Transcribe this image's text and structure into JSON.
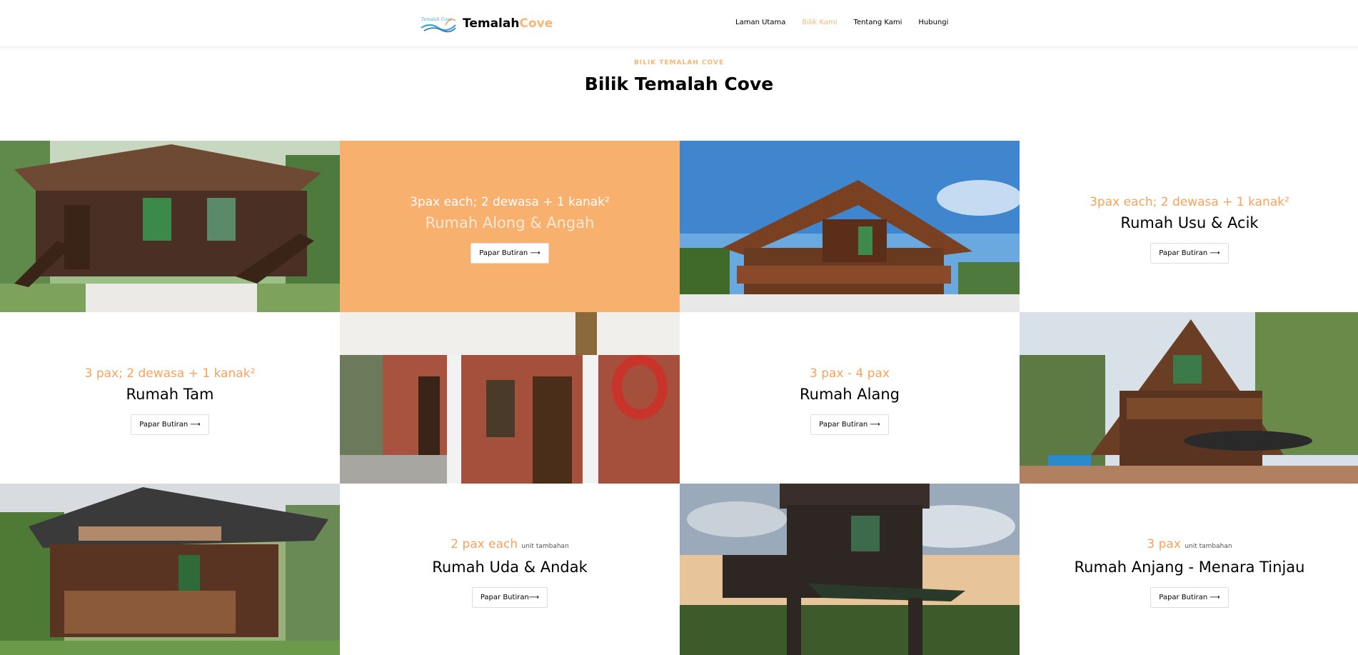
{
  "brand": {
    "logo_text": "Temalah Cove",
    "name_main": "Temalah",
    "name_accent": "Cove"
  },
  "nav": [
    {
      "label": "Laman Utama",
      "active": false
    },
    {
      "label": "Bilik Kami",
      "active": true
    },
    {
      "label": "Tentang Kami",
      "active": false
    },
    {
      "label": "Hubungi",
      "active": false
    }
  ],
  "section": {
    "subtitle": "BILIK TEMALAH COVE",
    "title": "Bilik Temalah Cove"
  },
  "rooms": [
    {
      "pax": "3pax each; 2 dewasa + 1 kanak²",
      "pax_note": "",
      "name": "Rumah Along & Angah",
      "button": "Papar Butiran ⟶"
    },
    {
      "pax": "3pax each; 2 dewasa + 1 kanak²",
      "pax_note": "",
      "name": "Rumah Usu & Acik",
      "button": "Papar Butiran ⟶"
    },
    {
      "pax": "3 pax; 2 dewasa + 1 kanak²",
      "pax_note": "",
      "name": "Rumah Tam",
      "button": "Papar Butiran ⟶"
    },
    {
      "pax": "3 pax - 4 pax",
      "pax_note": "",
      "name": "Rumah Alang",
      "button": "Papar Butiran ⟶"
    },
    {
      "pax": "2 pax each",
      "pax_note": "unit tambahan",
      "name": "Rumah Uda & Andak",
      "button": "Papar Butiran⟶"
    },
    {
      "pax": "3 pax",
      "pax_note": "unit tambahan",
      "name": "Rumah Anjang - Menara Tinjau",
      "button": "Papar Butiran ⟶"
    }
  ],
  "colors": {
    "accent": "#f8b575",
    "orange_panel": "#f8b06e",
    "text": "#000000"
  },
  "photos": [
    {
      "alt": "Wooden stilt house with carved roof trim"
    },
    {
      "alt": "Traditional timber house against blue sky"
    },
    {
      "alt": "Brick wall veranda with lifebuoy and lantern"
    },
    {
      "alt": "Tall timber house among trees"
    },
    {
      "alt": "Timber cottage with carved balcony"
    },
    {
      "alt": "Timber lookout tower at sunset"
    }
  ]
}
